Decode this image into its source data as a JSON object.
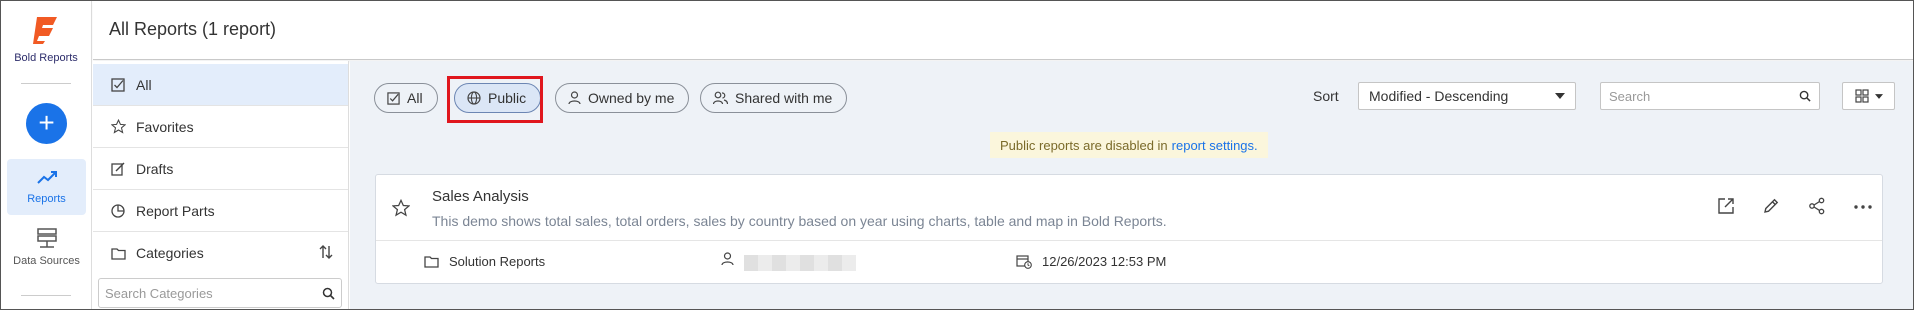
{
  "app": {
    "brand": "Bold Reports"
  },
  "rail": {
    "add_label": "+",
    "items": [
      {
        "label": "Reports",
        "icon": "trending-up-icon",
        "active": true
      },
      {
        "label": "Data Sources",
        "icon": "database-icon",
        "active": false
      }
    ]
  },
  "header": {
    "title": "All Reports (1 report)"
  },
  "categories": {
    "items": [
      {
        "label": "All",
        "icon": "checkbox-icon",
        "active": true
      },
      {
        "label": "Favorites",
        "icon": "star-icon"
      },
      {
        "label": "Drafts",
        "icon": "edit-icon"
      },
      {
        "label": "Report Parts",
        "icon": "pie-icon"
      },
      {
        "label": "Categories",
        "icon": "folder-icon"
      }
    ],
    "search_placeholder": "Search Categories"
  },
  "filters": {
    "chips": [
      {
        "label": "All",
        "icon": "checkbox-icon"
      },
      {
        "label": "Public",
        "icon": "globe-icon",
        "selected": true
      },
      {
        "label": "Owned by me",
        "icon": "user-icon"
      },
      {
        "label": "Shared with me",
        "icon": "users-icon"
      }
    ],
    "sort_label": "Sort",
    "sort_value": "Modified - Descending",
    "search_placeholder": "Search"
  },
  "notice": {
    "text": "Public reports are disabled in",
    "link": "report settings."
  },
  "report": {
    "title": "Sales Analysis",
    "description": "This demo shows total sales, total orders, sales by country based on year using charts, table and map in Bold Reports.",
    "category": "Solution Reports",
    "modified": "12/26/2023 12:53 PM"
  },
  "colors": {
    "accent": "#1a73e8",
    "highlight": "#e0161e",
    "logo": "#f15a24"
  }
}
